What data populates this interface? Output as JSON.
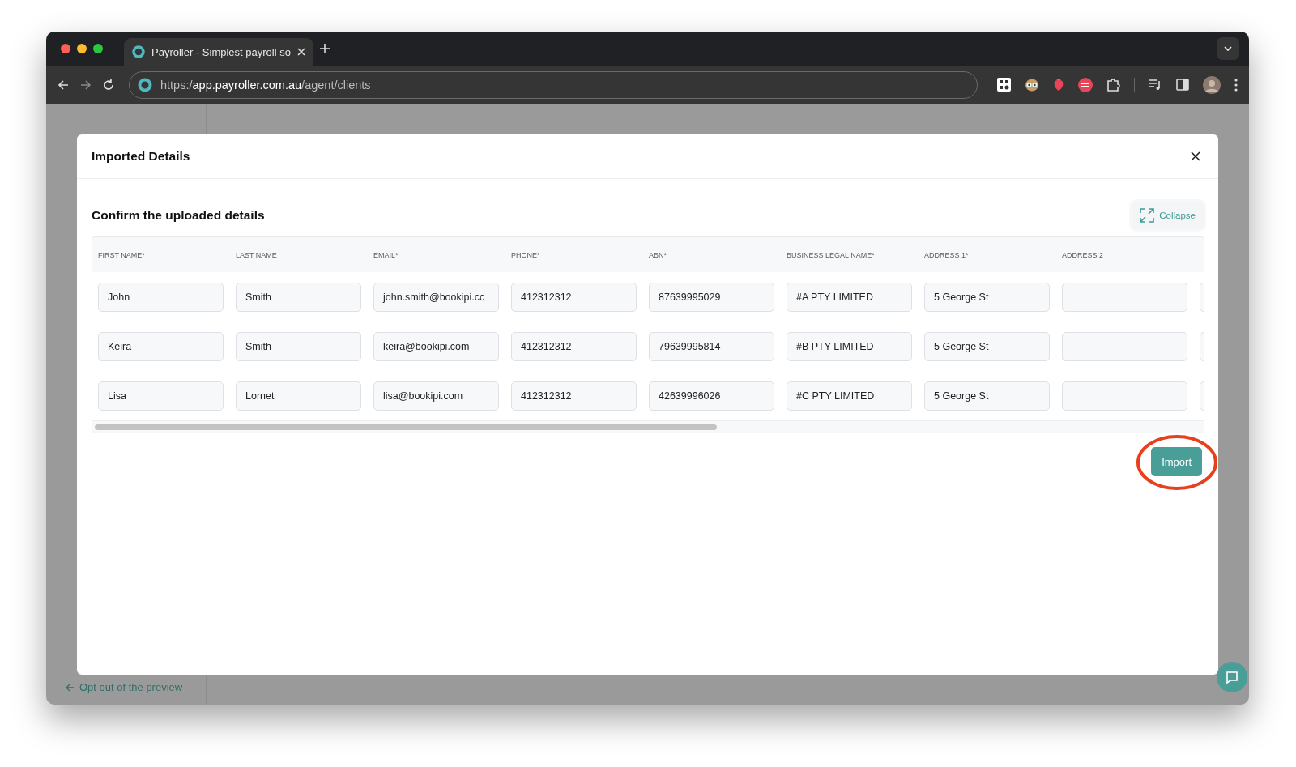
{
  "browser": {
    "tab_title": "Payroller - Simplest payroll so",
    "url_prefix": "https:/",
    "url_host": "app.payroller.com.au",
    "url_path": "/agent/clients"
  },
  "background": {
    "sidebar_link": "Opt out of the preview"
  },
  "modal": {
    "title": "Imported Details",
    "section_title": "Confirm the uploaded details",
    "collapse_button": "Collapse",
    "table": {
      "columns": [
        "FIRST NAME*",
        "LAST NAME",
        "EMAIL*",
        "PHONE*",
        "ABN*",
        "BUSINESS LEGAL NAME*",
        "ADDRESS 1*",
        "ADDRESS 2"
      ],
      "rows": [
        {
          "cells": [
            "John",
            "Smith",
            "john.smith@bookipi.cc",
            "412312312",
            "87639995029",
            "#A PTY LIMITED",
            "5 George St"
          ]
        },
        {
          "cells": [
            "Keira",
            "Smith",
            "keira@bookipi.com",
            "412312312",
            "79639995814",
            "#B PTY LIMITED",
            "5 George St"
          ]
        },
        {
          "cells": [
            "Lisa",
            "Lornet",
            "lisa@bookipi.com",
            "412312312",
            "42639996026",
            "#C PTY LIMITED",
            "5 George St"
          ]
        }
      ]
    },
    "import_button": "Import"
  }
}
